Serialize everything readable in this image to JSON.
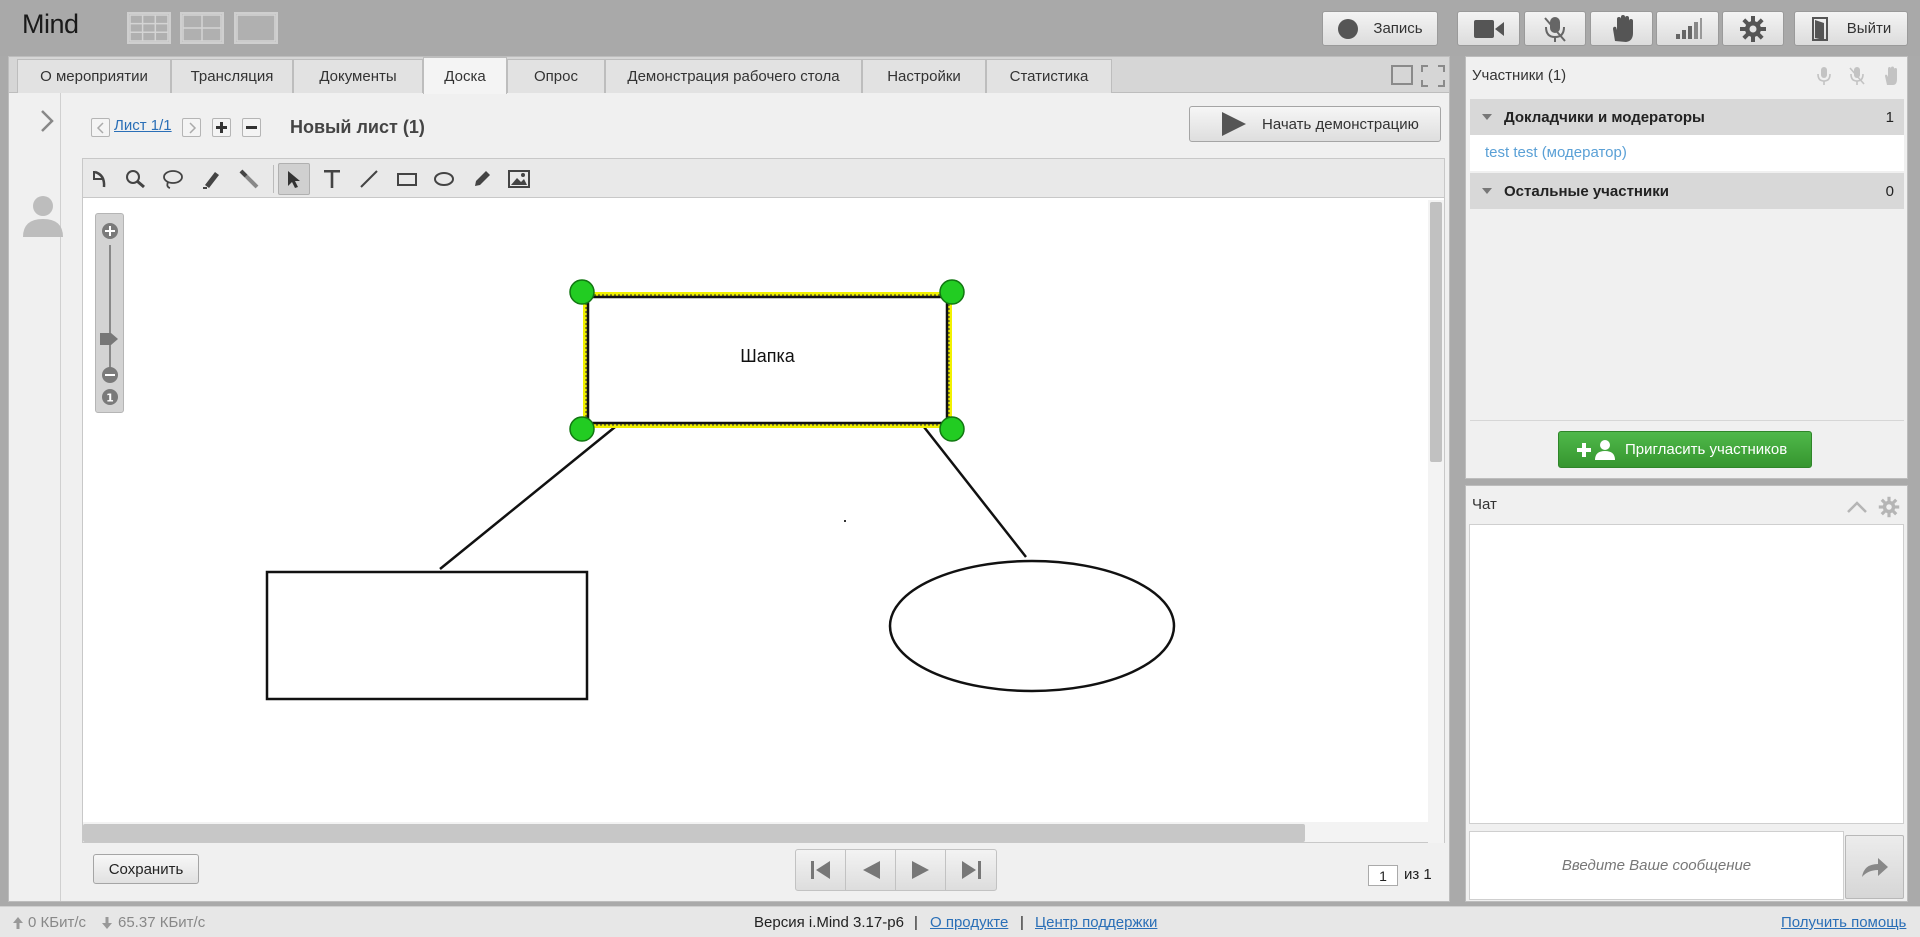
{
  "app": {
    "logo": "Mind"
  },
  "topbar": {
    "record_label": "Запись",
    "exit_label": "Выйти"
  },
  "tabs": [
    {
      "label": "О мероприятии"
    },
    {
      "label": "Трансляция"
    },
    {
      "label": "Документы"
    },
    {
      "label": "Доска",
      "active": true
    },
    {
      "label": "Опрос"
    },
    {
      "label": "Демонстрация рабочего стола"
    },
    {
      "label": "Настройки"
    },
    {
      "label": "Статистика"
    }
  ],
  "board": {
    "sheet_link": "Лист 1/1",
    "sheet_title": "Новый лист (1)",
    "start_demo_label": "Начать демонстрацию",
    "shape_text": "Шапка",
    "save_label": "Сохранить",
    "page_current": "1",
    "page_of": "из 1"
  },
  "participants": {
    "title": "Участники (1)",
    "group1": {
      "label": "Докладчики и модераторы",
      "count": "1"
    },
    "member": "test test (модератор)",
    "group2": {
      "label": "Остальные участники",
      "count": "0"
    },
    "invite_label": "Пригласить участников"
  },
  "chat": {
    "title": "Чат",
    "placeholder": "Введите Ваше сообщение"
  },
  "status": {
    "upload": "0 КБит/с",
    "download": "65.37 КБит/с",
    "version": "Версия i.Mind 3.17-p6",
    "sep1": "|",
    "about_link": "О продукте",
    "sep2": "|",
    "support_link": "Центр поддержки",
    "help_link": "Получить помощь"
  },
  "colors": {
    "selection_handle": "#22cc22",
    "selection_outline": "#f2f200",
    "invite_green": "#3ea637",
    "link_blue": "#2a6fb7"
  }
}
